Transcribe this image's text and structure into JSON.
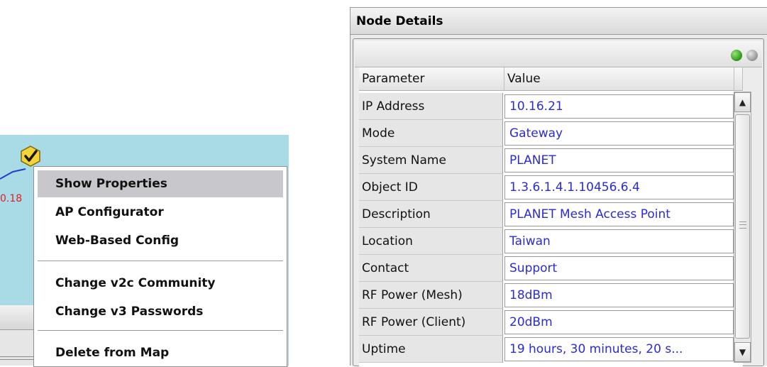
{
  "map": {
    "node_label": "0.18"
  },
  "context_menu": {
    "items": [
      {
        "label": "Show Properties",
        "selected": true
      },
      {
        "label": "AP Configurator"
      },
      {
        "label": "Web-Based Config"
      },
      {
        "label": "Change v2c Community"
      },
      {
        "label": "Change v3 Passwords"
      },
      {
        "label": "Delete from Map"
      }
    ]
  },
  "node_details": {
    "title": "Node Details",
    "columns": {
      "parameter": "Parameter",
      "value": "Value"
    },
    "rows": [
      {
        "parameter": "IP Address",
        "value": "10.16.21"
      },
      {
        "parameter": "Mode",
        "value": "Gateway"
      },
      {
        "parameter": "System Name",
        "value": "PLANET"
      },
      {
        "parameter": "Object ID",
        "value": "1.3.6.1.4.1.10456.6.4"
      },
      {
        "parameter": "Description",
        "value": "PLANET Mesh Access Point"
      },
      {
        "parameter": "Location",
        "value": "Taiwan"
      },
      {
        "parameter": "Contact",
        "value": "Support"
      },
      {
        "parameter": "RF Power (Mesh)",
        "value": "18dBm"
      },
      {
        "parameter": "RF Power (Client)",
        "value": "20dBm"
      },
      {
        "parameter": "Uptime",
        "value": "19 hours, 30 minutes, 20 s..."
      }
    ],
    "status_colors": {
      "green": "#2f9d1c",
      "gray": "#9a9a9a"
    }
  },
  "colors": {
    "map_background": "#a8dbe5",
    "value_text": "#2a2ad8",
    "node_label": "#e02020"
  }
}
